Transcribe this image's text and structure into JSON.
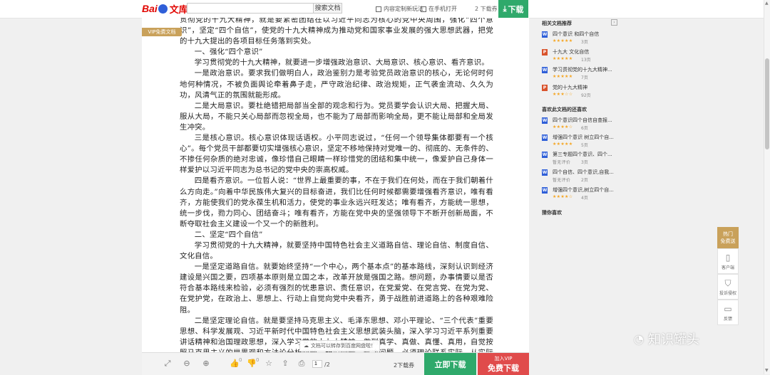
{
  "topbar": {
    "logo_left": "Bai",
    "logo_right": "文库",
    "search_value": "",
    "search_button": "搜索文档",
    "link1": "内容定制新玩法",
    "link2": "在手机打开",
    "downloads": "2 下载券",
    "download_button": "下载"
  },
  "document": {
    "vip_tag": "VIP免费文档",
    "paragraphs": [
      "贯彻党的十九大精神，就是要紧密团结在以习近平同志为核心的党中央周围，强化“四个意识”，坚定“四个自信”，使党的十九大精神成为推动党和国家事业发展的强大思想武器，把党的十九大提出的各项目标任务落到实处。",
      "一、强化“四个意识”",
      "学习贯彻党的十九大精神，就要进一步增强政治意识、大局意识、核心意识、看齐意识。",
      "一是政治意识。要求我们做明白人，政治鉴别力是考验党员政治意识的核心，无论何时何地何种情况，不被负面舆论牵着鼻子走，严守政治纪律、政治规矩，正气袭金流动、久久为功，风清气正的氛围就能形成。",
      "二是大局意识。要杜绝错把局部当全部的观念和行为。党员要学会认识大局、把握大局、服从大局，不能只关心局部而忽视全局，也不能为了局部而影响全局，更不能让局部和全局发生冲突。",
      "三是核心意识。核心意识体现话语权。小平同志说过，“任何一个领导集体都要有一个核心”。每个党员干部都要切实增强核心意识，坚定不移地保持对党唯一的、彻底的、无条件的、不掺任何杂质的绝对忠诚，像珍惜自己眼睛一样珍惜党的团结和集中统一，像爱护自己身体一样爱护以习近平同志为总书记的党中央的崇高权威。",
      "四是看齐意识。一位哲人说：“世界上最重要的事，不在于我们在何处，而在于我们朝着什么方向走。”向着中华民族伟大复兴的目标奋进，我们比任何时候都需要增强看齐意识，唯有看齐，方能使我们的党永葆生机和活力，使党的事业永远兴旺发达；唯有看齐，方能统一思想，统一步伐，勠力同心、团结奋斗；唯有看齐，方能在党中央的坚强领导下不断开创新局面，不断夺取社会主义建设一个又一个的新胜利。",
      "二、坚定“四个自信”",
      "学习贯彻党的十九大精神，就要坚持中国特色社会主义道路自信、理论自信、制度自信、文化自信。",
      "一是坚定道路自信。就要始终坚持“一个中心，两个基本点”的基本路线，深刻认识到经济建设是兴国之要，四项基本原则是立国之本，改革开放是强国之路。想问题，办事情要以是否符合基本路线来检验，必须有强烈的忧患意识、责任意识，在党爱党、在党言党、在党为党、在党护党，在政治上、思想上、行动上自觉向党中央看齐，勇于战胜前进道路上的各种艰难险阻。",
      "二是坚定理论自信。就是要坚持马克思主义、毛泽东思想、邓小平理论、“三个代表”重要思想、科学发展观、习近平新时代中国特色社会主义思想武装头脑，深入学习习近平系列重要讲话精神和治国理政思想，深入学习党的十九大精神，做到真学、真做、真懂、真用，自觉按照马克思主义的世界观和方法论分析问题、研究问题、解决问题。必须理论联系实际，从实际出发，一切从马克思主义、毛泽东思想、邓小平理论、“三个代表”重要思想、科学发展观、习近平新时代中国特色社会主义思想等理论成果中汲取营养，使"
    ],
    "toast": "文档可以转存到百度网盘啦！"
  },
  "bottombar": {
    "like_count": "0",
    "dislike_count": "0",
    "page_current": "1",
    "page_total": "/2",
    "download_count": "2下载券",
    "download_button": "立即下载",
    "vip_line1": "加入VIP",
    "vip_line2": "免费下载"
  },
  "sidebar": {
    "related_title": "相关文档推荐",
    "related": [
      {
        "icon": "W",
        "title": "四个意识 和四个自信",
        "stars": "★★★★★",
        "pages": "3页"
      },
      {
        "icon": "P",
        "title": "十九大 文化自信",
        "stars": "★★★★★",
        "pages": "13页"
      },
      {
        "icon": "W",
        "title": "学习贯彻党的十九大精神...",
        "stars": "★★★★★",
        "pages": "7页"
      },
      {
        "icon": "P",
        "title": "党的十九大精神",
        "stars": "★★★☆☆",
        "pages": "92页"
      }
    ],
    "also_title": "喜欢此文档的还喜欢",
    "also": [
      {
        "icon": "W",
        "title": "四个意识四个自信自查报...",
        "stars": "★★★★☆",
        "pages": "6页"
      },
      {
        "icon": "W",
        "title": "增强四个意识 树立四个自...",
        "stars": "★★★★★",
        "pages": "5页"
      },
      {
        "icon": "W",
        "title": "第三专题四个意识、四个...",
        "stars": "暂无评价",
        "pages": "3页"
      },
      {
        "icon": "W",
        "title": "四个自信、四个意识,自我...",
        "stars": "暂无评价",
        "pages": "2页"
      },
      {
        "icon": "W",
        "title": "增强四个意识,树立四个自...",
        "stars": "★★★★☆",
        "pages": "4页"
      }
    ],
    "guess_title": "猜你喜欢"
  },
  "tools": {
    "hot": [
      "热门",
      "免费送"
    ],
    "items": [
      "客户端",
      "投诉侵权",
      "反馈"
    ]
  },
  "watermark": "知识罐头"
}
